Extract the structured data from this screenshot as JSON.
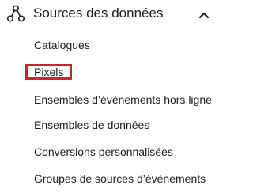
{
  "section": {
    "title": "Sources des données",
    "icon": "data-sources-icon",
    "expanded": true,
    "toggle_icon": "chevron-up-icon",
    "items": [
      {
        "label": "Catalogues"
      },
      {
        "label": "Pixels",
        "highlighted": true
      },
      {
        "label": "Ensembles d’évènements hors ligne"
      },
      {
        "label": "Ensembles de données"
      },
      {
        "label": "Conversions personnalisées"
      },
      {
        "label": "Groupes de sources d’évènements"
      }
    ]
  },
  "colors": {
    "text": "#1c1e21",
    "highlight": "#d0242b",
    "background": "#ffffff"
  }
}
